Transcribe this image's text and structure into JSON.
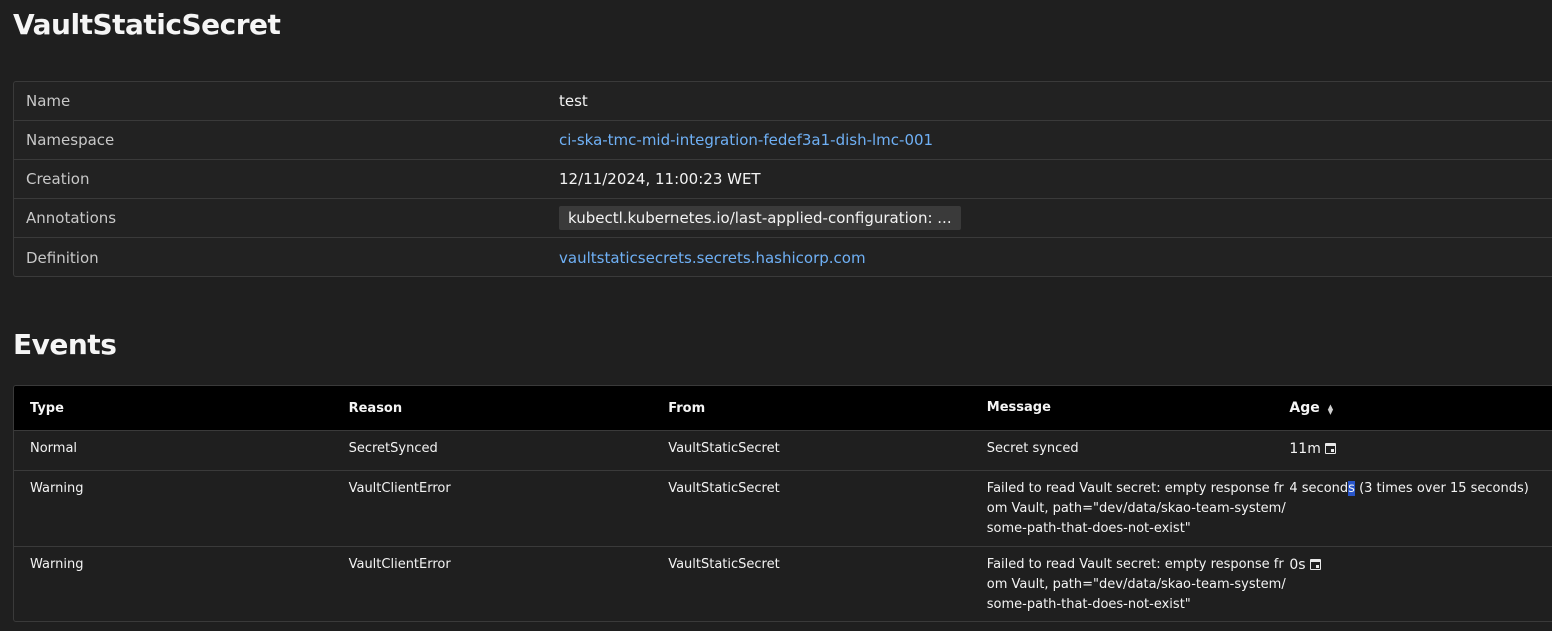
{
  "title": "VaultStaticSecret",
  "metadata": {
    "rows": [
      {
        "key": "Name",
        "value": "test"
      },
      {
        "key": "Namespace",
        "value": "ci-ska-tmc-mid-integration-fedef3a1-dish-lmc-001"
      },
      {
        "key": "Creation",
        "value": "12/11/2024, 11:00:23 WET"
      },
      {
        "key": "Annotations",
        "value": "kubectl.kubernetes.io/last-applied-configuration: ..."
      },
      {
        "key": "Definition",
        "value": "vaultstaticsecrets.secrets.hashicorp.com"
      }
    ]
  },
  "events": {
    "title": "Events",
    "columns": {
      "type": "Type",
      "reason": "Reason",
      "from": "From",
      "message": "Message",
      "age": "Age"
    },
    "rows": [
      {
        "type": "Normal",
        "reason": "SecretSynced",
        "from": "VaultStaticSecret",
        "message": "Secret synced",
        "age": "11m"
      },
      {
        "type": "Warning",
        "reason": "VaultClientError",
        "from": "VaultStaticSecret",
        "message": "Failed to read Vault secret: empty response from Vault, path=\"dev/data/skao-team-system/some-path-that-does-not-exist\"",
        "age_pre": "4 second",
        "age_highlight": "s",
        "age_post": " (3 times over 15 seconds)"
      },
      {
        "type": "Warning",
        "reason": "VaultClientError",
        "from": "VaultStaticSecret",
        "message": "Failed to read Vault secret: empty response from Vault, path=\"dev/data/skao-team-system/some-path-that-does-not-exist\"",
        "age": "0s"
      }
    ]
  },
  "icons": {
    "sort": "sort-icon",
    "age": "calendar-icon"
  },
  "colors": {
    "background": "#1f1f1f",
    "link": "#6fb0f5",
    "header_bg": "#000000",
    "selection": "#2855c9"
  }
}
